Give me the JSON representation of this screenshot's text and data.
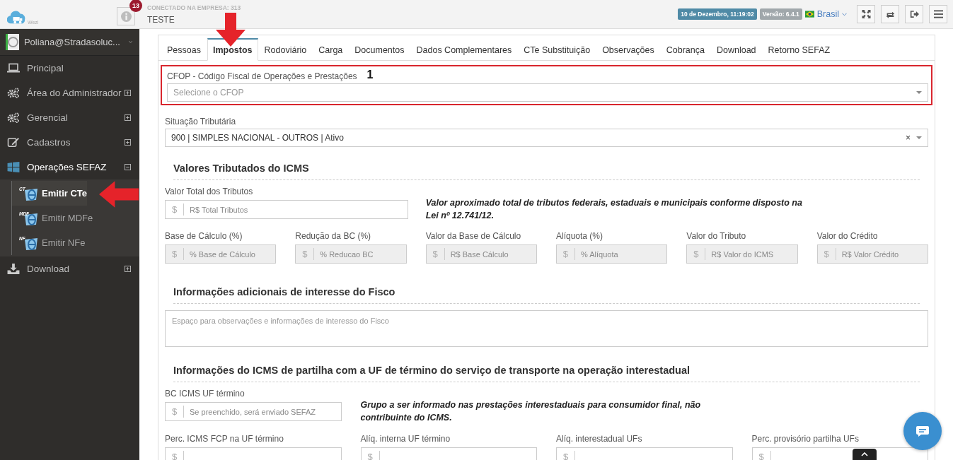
{
  "header": {
    "logo_text": "Wezi",
    "notifications": "13",
    "company_label": "CONECTADO NA EMPRESA: 313",
    "company_name": "TESTE",
    "datetime": "10 de Dezembro, 11:19:02",
    "version": "Versão: 6.4.1",
    "language": "Brasil"
  },
  "sidebar": {
    "user": "Poliana@Stradasoluc...",
    "items": [
      {
        "label": "Principal"
      },
      {
        "label": "Área do Administrador",
        "expanded": false
      },
      {
        "label": "Gerencial",
        "expanded": false
      },
      {
        "label": "Cadastros",
        "expanded": false
      },
      {
        "label": "Operações SEFAZ",
        "expanded": true,
        "children": [
          {
            "label": "Emitir CTe",
            "icon_text": "CT",
            "selected": true
          },
          {
            "label": "Emitir MDFe",
            "icon_text": "MDF",
            "selected": false
          },
          {
            "label": "Emitir NFe",
            "icon_text": "NF",
            "selected": false
          }
        ]
      },
      {
        "label": "Download",
        "expanded": false
      }
    ]
  },
  "tabs": [
    {
      "label": "Pessoas",
      "selected": false
    },
    {
      "label": "Impostos",
      "selected": true
    },
    {
      "label": "Rodoviário",
      "selected": false
    },
    {
      "label": "Carga",
      "selected": false
    },
    {
      "label": "Documentos",
      "selected": false
    },
    {
      "label": "Dados Complementares",
      "selected": false
    },
    {
      "label": "CTe Substituição",
      "selected": false
    },
    {
      "label": "Observações",
      "selected": false
    },
    {
      "label": "Cobrança",
      "selected": false
    },
    {
      "label": "Download",
      "selected": false
    },
    {
      "label": "Retorno SEFAZ",
      "selected": false
    }
  ],
  "cfop": {
    "label": "CFOP - Código Fiscal de Operações e Prestações",
    "placeholder": "Selecione o CFOP",
    "annotation": "1"
  },
  "situacao": {
    "label": "Situação Tributária",
    "value": "900 | SIMPLES NACIONAL - OUTROS | Ativo",
    "clear": "×"
  },
  "icms": {
    "title": "Valores Tributados do ICMS",
    "total": {
      "label": "Valor Total dos Tributos",
      "placeholder": "R$ Total Tributos",
      "prefix": "$",
      "disabled": false
    },
    "note": "Valor aproximado total de tributos federais, estaduais e municipais conforme disposto na Lei nº 12.741/12.",
    "fields": [
      {
        "label": "Base de Cálculo (%)",
        "placeholder": "% Base de Cálculo",
        "prefix": "$",
        "disabled": true
      },
      {
        "label": "Redução da BC (%)",
        "placeholder": "% Reducao BC",
        "prefix": "$",
        "disabled": true
      },
      {
        "label": "Valor da Base de Cálculo",
        "placeholder": "R$ Base Cálculo",
        "prefix": "$",
        "disabled": true
      },
      {
        "label": "Alíquota (%)",
        "placeholder": "% Alíquota",
        "prefix": "$",
        "disabled": true
      },
      {
        "label": "Valor do Tributo",
        "placeholder": "R$ Valor do ICMS",
        "prefix": "$",
        "disabled": true
      },
      {
        "label": "Valor do Crédito",
        "placeholder": "R$ Valor Crédito",
        "prefix": "$",
        "disabled": true
      }
    ]
  },
  "fisco": {
    "title": "Informações adicionais de interesse do Fisco",
    "placeholder": "Espaço para observações e informações de interesso do Fisco"
  },
  "partilha": {
    "title": "Informações do ICMS de partilha com a UF de término do serviço de transporte na operação interestadual",
    "bc": {
      "label": "BC ICMS UF término",
      "placeholder": "Se preenchido, será enviado SEFAZ",
      "prefix": "$",
      "disabled": false
    },
    "note": "Grupo a ser informado nas prestações interestaduais para consumidor final, não contribuinte do ICMS.",
    "fields": [
      {
        "label": "Perc. ICMS FCP na UF término",
        "prefix": "$",
        "disabled": false
      },
      {
        "label": "Alíq. interna UF término",
        "prefix": "$",
        "disabled": false
      },
      {
        "label": "Alíq. interestadual UFs",
        "prefix": "$",
        "disabled": false
      },
      {
        "label": "Perc. provisório partilha UFs",
        "prefix": "$",
        "disabled": false
      }
    ]
  }
}
